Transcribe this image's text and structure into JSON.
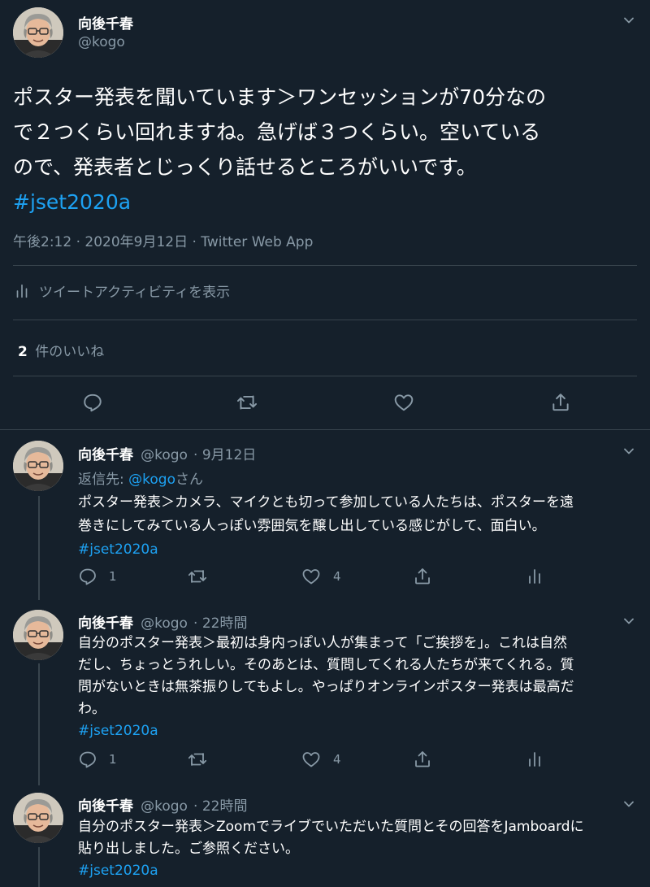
{
  "main_tweet": {
    "author_name": "向後千春",
    "author_handle": "@kogo",
    "text_lines": [
      "ポスター発表を聞いています＞ワンセッションが70分なの",
      "で２つくらい回れますね。急げば３つくらい。空いている",
      "ので、発表者とじっくり話せるところがいいです。"
    ],
    "hashtag": "#jset2020a",
    "meta": "午後2:12 · 2020年9月12日 · Twitter Web App",
    "activity_label": "ツイートアクティビティを表示",
    "likes_count": "2",
    "likes_label": "件のいいね"
  },
  "replies": [
    {
      "author_name": "向後千春",
      "author_handle": "@kogo",
      "time": "· 9月12日",
      "reply_to_prefix": "返信先: ",
      "reply_to_handle": "@kogo",
      "reply_to_suffix": "さん",
      "text_lines": [
        "ポスター発表＞カメラ、マイクとも切って参加している人たちは、ポスターを遠",
        "巻きにしてみている人っぽい雰囲気を醸し出している感じがして、面白い。"
      ],
      "hashtag": "#jset2020a",
      "reply_count": "1",
      "like_count": "4"
    },
    {
      "author_name": "向後千春",
      "author_handle": "@kogo",
      "time": "· 22時間",
      "text_lines": [
        "自分のポスター発表＞最初は身内っぽい人が集まって「ご挨拶を」。これは自然",
        "だし、ちょっとうれしい。そのあとは、質問してくれる人たちが来てくれる。質",
        "問がないときは無茶振りしてもよし。やっぱりオンラインポスター発表は最高だ",
        "わ。"
      ],
      "hashtag": "#jset2020a",
      "reply_count": "1",
      "like_count": "4"
    },
    {
      "author_name": "向後千春",
      "author_handle": "@kogo",
      "time": "· 22時間",
      "text_lines": [
        "自分のポスター発表＞Zoomでライブでいただいた質問とその回答をJamboardに",
        "貼り出しました。ご参照ください。"
      ],
      "hashtag": "#jset2020a"
    }
  ],
  "icons": {
    "chevron": "chevron-down-icon",
    "reply": "reply-icon",
    "retweet": "retweet-icon",
    "like": "heart-icon",
    "share": "share-icon",
    "analytics": "analytics-icon"
  },
  "colors": {
    "background": "#15202b",
    "link": "#1da1f2",
    "muted": "#8899a6",
    "divider": "#38444d"
  }
}
